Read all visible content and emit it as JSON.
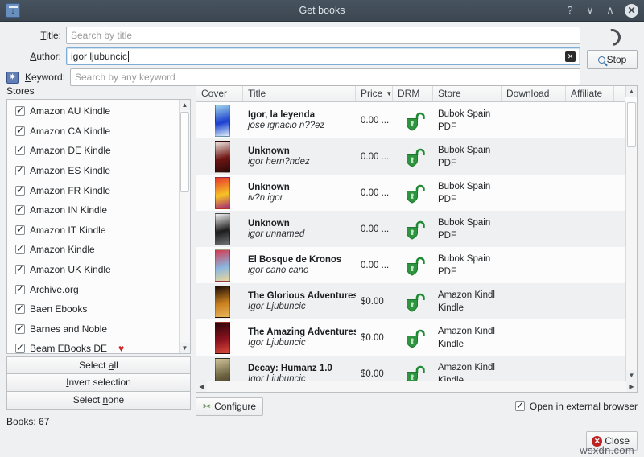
{
  "window": {
    "title": "Get books",
    "app_icon": "book-download-icon",
    "buttons": {
      "help": "?",
      "shade": "∨",
      "unshade": "∧",
      "close": "✕"
    }
  },
  "search": {
    "title": {
      "label": "Title:",
      "value": "",
      "placeholder": "Search by title"
    },
    "author": {
      "label": "Author:",
      "value": "igor ljubuncic",
      "placeholder": "Search by author",
      "clear_icon": "clear-x-icon"
    },
    "keyword": {
      "label": "Keyword:",
      "value": "",
      "placeholder": "Search by any keyword",
      "gear_icon": "gear-icon"
    },
    "stop_button": {
      "label": "Stop",
      "icon": "search-magnifier-icon"
    },
    "busy_indicator": "spinner-icon"
  },
  "stores": {
    "label": "Stores",
    "items": [
      {
        "label": "Amazon AU Kindle",
        "checked": true,
        "favorite": false
      },
      {
        "label": "Amazon CA Kindle",
        "checked": true,
        "favorite": false
      },
      {
        "label": "Amazon DE Kindle",
        "checked": true,
        "favorite": false
      },
      {
        "label": "Amazon ES Kindle",
        "checked": true,
        "favorite": false
      },
      {
        "label": "Amazon FR Kindle",
        "checked": true,
        "favorite": false
      },
      {
        "label": "Amazon IN Kindle",
        "checked": true,
        "favorite": false
      },
      {
        "label": "Amazon IT Kindle",
        "checked": true,
        "favorite": false
      },
      {
        "label": "Amazon Kindle",
        "checked": true,
        "favorite": false
      },
      {
        "label": "Amazon UK Kindle",
        "checked": true,
        "favorite": false
      },
      {
        "label": "Archive.org",
        "checked": true,
        "favorite": false
      },
      {
        "label": "Baen Ebooks",
        "checked": true,
        "favorite": false
      },
      {
        "label": "Barnes and Noble",
        "checked": true,
        "favorite": false
      },
      {
        "label": "Beam EBooks DE",
        "checked": true,
        "favorite": true
      }
    ],
    "buttons": {
      "select_all": "Select all",
      "invert_selection": "Invert selection",
      "select_none": "Select none"
    },
    "count_label": "Books:  67"
  },
  "results": {
    "columns": [
      {
        "label": "Cover",
        "width": 58
      },
      {
        "label": "Title",
        "width": 140
      },
      {
        "label": "Price",
        "width": 46,
        "sorted": true,
        "sort_mark": "▼"
      },
      {
        "label": "DRM",
        "width": 50
      },
      {
        "label": "Store",
        "width": 85
      },
      {
        "label": "Download",
        "width": 80
      },
      {
        "label": "Affiliate",
        "width": 60
      }
    ],
    "rows": [
      {
        "title": "Igor, la leyenda",
        "author": "jose ignacio n??ez",
        "price": "0.00 ...",
        "drm": "drm-free-open-lock-icon",
        "store": "Bubok Spain",
        "format": "PDF",
        "download": "",
        "affiliate": "",
        "cover_colors": [
          "#9fd3ea",
          "#1a3fcf",
          "#dff0f8"
        ]
      },
      {
        "title": "Unknown",
        "author": "igor hern?ndez",
        "price": "0.00 ...",
        "drm": "drm-free-open-lock-icon",
        "store": "Bubok Spain",
        "format": "PDF",
        "download": "",
        "affiliate": "",
        "cover_colors": [
          "#efe7e0",
          "#6e1614",
          "#2a0a08"
        ]
      },
      {
        "title": "Unknown",
        "author": "iv?n igor",
        "price": "0.00 ...",
        "drm": "drm-free-open-lock-icon",
        "store": "Bubok Spain",
        "format": "PDF",
        "download": "",
        "affiliate": "",
        "cover_colors": [
          "#e8362c",
          "#f6c324",
          "#a3287a"
        ]
      },
      {
        "title": "Unknown",
        "author": "igor unnamed",
        "price": "0.00 ...",
        "drm": "drm-free-open-lock-icon",
        "store": "Bubok Spain",
        "format": "PDF",
        "download": "",
        "affiliate": "",
        "cover_colors": [
          "#f2f2f2",
          "#1c1c1c",
          "#6f7377"
        ]
      },
      {
        "title": "El Bosque de Kronos",
        "author": "igor cano cano",
        "price": "0.00 ...",
        "drm": "drm-free-open-lock-icon",
        "store": "Bubok Spain",
        "format": "PDF",
        "download": "",
        "affiliate": "",
        "cover_colors": [
          "#d23a52",
          "#8ab6e0",
          "#e9d79a"
        ]
      },
      {
        "title": "The Glorious Adventures of",
        "author": "Igor Ljubuncic",
        "price": "$0.00",
        "drm": "drm-free-open-lock-icon",
        "store": "Amazon Kindl",
        "format": "Kindle",
        "download": "",
        "affiliate": "",
        "cover_colors": [
          "#1a0c06",
          "#c9801e",
          "#e8b75c"
        ]
      },
      {
        "title": "The Amazing Adventures o",
        "author": "Igor Ljubuncic",
        "price": "$0.00",
        "drm": "drm-free-open-lock-icon",
        "store": "Amazon Kindl",
        "format": "Kindle",
        "download": "",
        "affiliate": "",
        "cover_colors": [
          "#2a0508",
          "#8c1220",
          "#d94b3a"
        ]
      },
      {
        "title": "Decay: Humanz 1.0",
        "author": "Igor Ljubuncic",
        "price": "$0.00",
        "drm": "drm-free-open-lock-icon",
        "store": "Amazon Kindl",
        "format": "Kindle",
        "download": "",
        "affiliate": "",
        "cover_colors": [
          "#cfc49a",
          "#6b6240",
          "#3a3528"
        ]
      }
    ]
  },
  "footer": {
    "configure_button": {
      "label": "Configure",
      "icon": "wrench-icon"
    },
    "external_browser": {
      "label": "Open in external browser",
      "checked": true
    },
    "close_button": {
      "label": "Close",
      "icon": "close-circle-icon"
    },
    "watermark": "wsxdn.com"
  },
  "colors": {
    "titlebar": "#3f4a55",
    "accent_blue": "#3a6ea5",
    "drm_green": "#2e9440",
    "favorite_red": "#cc2222",
    "close_red": "#bb2222",
    "row_odd": "#fcfcfc",
    "row_even": "#eef0f2"
  }
}
